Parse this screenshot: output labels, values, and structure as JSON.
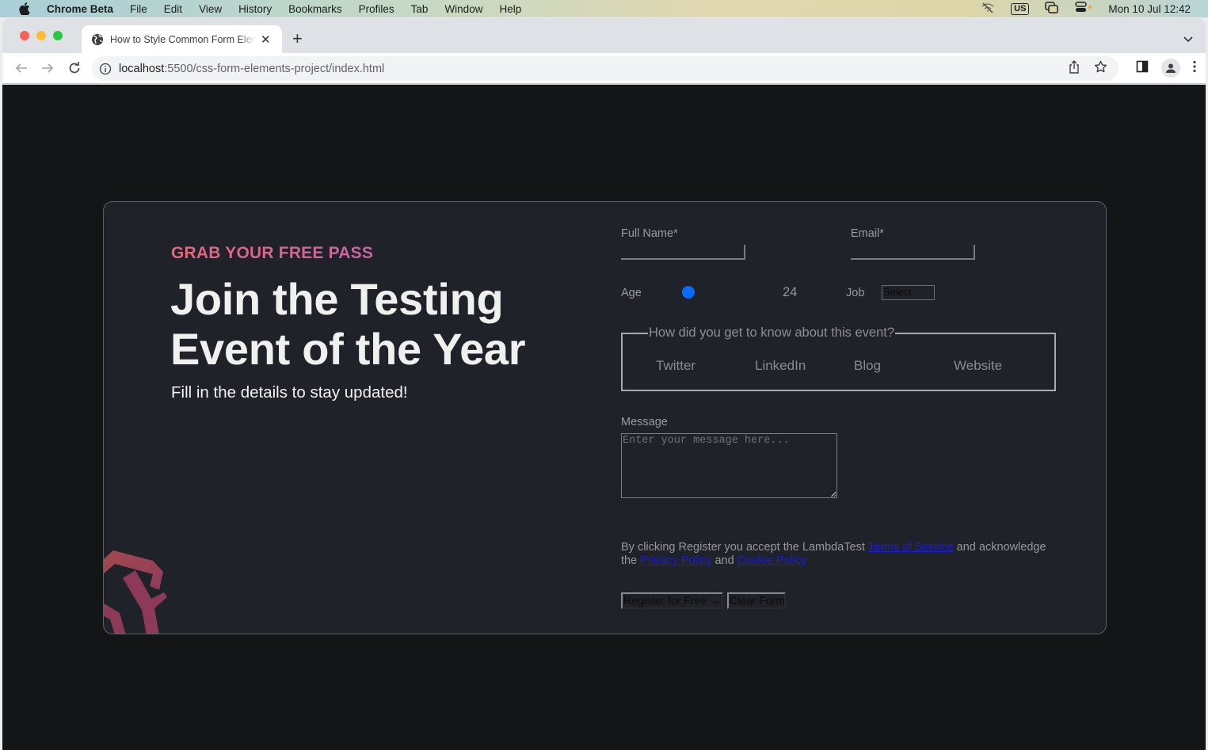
{
  "menubar": {
    "app_name": "Chrome Beta",
    "items": [
      "File",
      "Edit",
      "View",
      "History",
      "Bookmarks",
      "Profiles",
      "Tab",
      "Window",
      "Help"
    ],
    "status": {
      "input_source": "US",
      "datetime": "Mon 10 Jul  12:42"
    }
  },
  "browser": {
    "tab": {
      "title": "How to Style Common Form Elements",
      "close_icon": "close-icon"
    },
    "new_tab_label": "+",
    "address": {
      "host": "localhost",
      "path": ":5500/css-form-elements-project/index.html"
    }
  },
  "page": {
    "eyebrow": "GRAB YOUR FREE PASS",
    "headline": "Join the Testing Event of the Year",
    "subhead": "Fill in the details to stay updated!",
    "brand_colors": {
      "gradient_start": "#e7667a",
      "gradient_end": "#c767a6",
      "accent_blue": "#0a6cff"
    },
    "form": {
      "full_name": {
        "label": "Full Name*",
        "value": ""
      },
      "email": {
        "label": "Email*",
        "value": ""
      },
      "age": {
        "label": "Age",
        "value": "24",
        "slider_fraction": 0.0
      },
      "job": {
        "label": "Job",
        "selected": "Select"
      },
      "source": {
        "legend": "How did you get to know about this event?",
        "options": [
          "Twitter",
          "LinkedIn",
          "Blog",
          "Website"
        ]
      },
      "message": {
        "label": "Message",
        "placeholder": "Enter your message here...",
        "value": ""
      },
      "legal": {
        "prefix": "By clicking Register you accept the LambdaTest ",
        "terms_link": "Terms of Service",
        "middle": " and acknowledge the ",
        "privacy_link": "Privacy Policy",
        "and": " and ",
        "cookie_link": "Cookie Policy"
      },
      "register_button": "Register for Free →",
      "clear_button": "Clear Form"
    }
  }
}
